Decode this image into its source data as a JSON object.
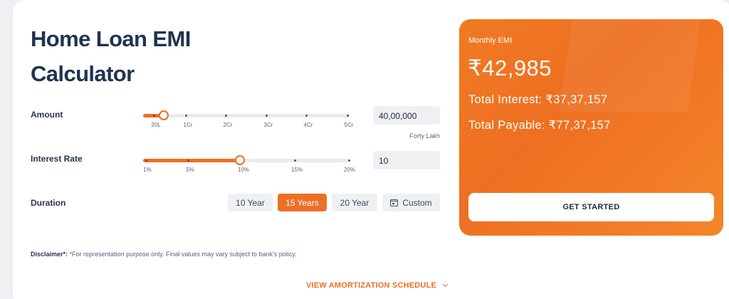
{
  "title": "Home Loan EMI Calculator",
  "amount": {
    "label": "Amount",
    "value": "40,00,000",
    "in_words": "Forty Lakh",
    "ticks": [
      "20L",
      "1Cr",
      "2Cr",
      "3Cr",
      "4Cr",
      "5Cr"
    ],
    "slider_fraction": 0.1
  },
  "interest": {
    "label": "Interest Rate",
    "value": "10",
    "ticks": [
      "1%",
      "5%",
      "10%",
      "15%",
      "20%"
    ],
    "slider_fraction": 0.47
  },
  "duration": {
    "label": "Duration",
    "options": [
      "10 Year",
      "15 Years",
      "20 Year",
      "Custom"
    ],
    "selected": "15 Years"
  },
  "disclaimer": {
    "label": "Disclaimer*:",
    "text": " *For representation purpose only. Final values may vary subject to bank's policy."
  },
  "amortization_link": "VIEW AMORTIZATION SCHEDULE",
  "result": {
    "emi_label": "Monthly EMI",
    "emi_value": "₹42,985",
    "total_interest": "Total Interest: ₹37,37,157",
    "total_payable": "Total Payable: ₹77,37,157",
    "cta": "GET STARTED"
  },
  "colors": {
    "accent": "#ee6f24",
    "text": "#1f3350",
    "field_bg": "#eef0f4"
  },
  "icons": {
    "custom": "calendar-icon",
    "amortization": "chevron-down-icon"
  }
}
